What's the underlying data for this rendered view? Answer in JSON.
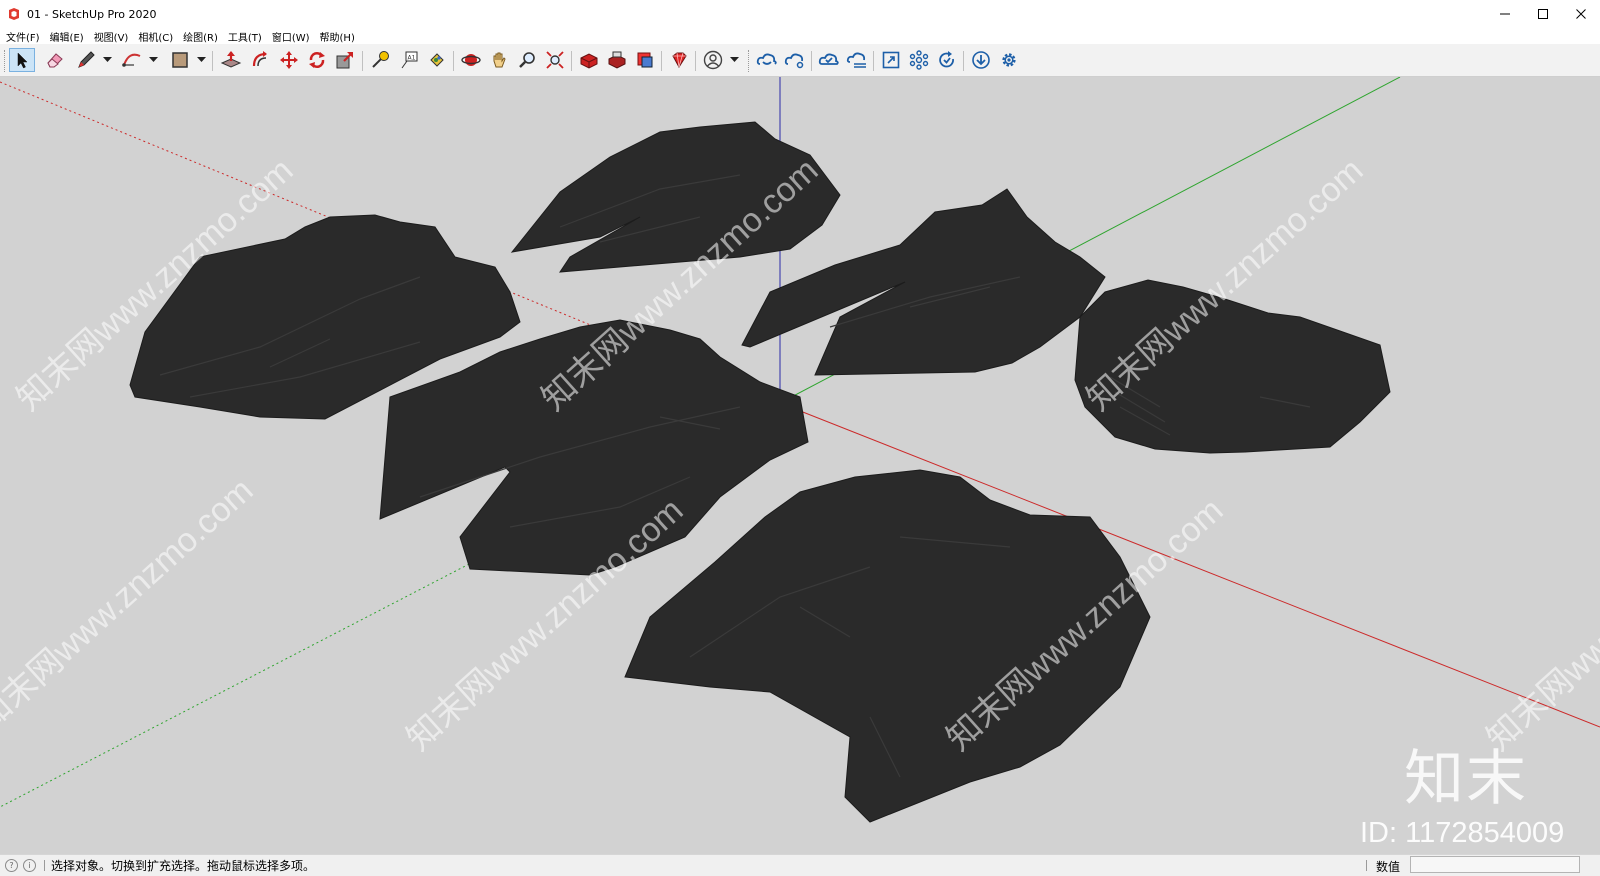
{
  "window": {
    "title": "01 - SketchUp Pro 2020",
    "controls": [
      "minimize-icon",
      "maximize-icon",
      "close-icon"
    ]
  },
  "menu": [
    {
      "label": "文件(F)"
    },
    {
      "label": "编辑(E)"
    },
    {
      "label": "视图(V)"
    },
    {
      "label": "相机(C)"
    },
    {
      "label": "绘图(R)"
    },
    {
      "label": "工具(T)"
    },
    {
      "label": "窗口(W)"
    },
    {
      "label": "帮助(H)"
    }
  ],
  "toolbar": {
    "tools": [
      {
        "name": "select-tool",
        "icon": "arrow-cursor-icon",
        "active": true
      },
      {
        "name": "eraser-tool",
        "icon": "eraser-icon"
      },
      {
        "name": "pencil-tool",
        "icon": "pencil-icon",
        "dropdown": true
      },
      {
        "name": "arc-tool",
        "icon": "arc-icon",
        "dropdown": true
      },
      {
        "name": "rectangle-tool",
        "icon": "rectangle-icon",
        "dropdown": true
      },
      {
        "name": "push-pull-tool",
        "icon": "push-pull-icon"
      },
      {
        "name": "offset-tool",
        "icon": "offset-icon"
      },
      {
        "name": "move-tool",
        "icon": "move-icon"
      },
      {
        "name": "rotate-tool",
        "icon": "rotate-icon"
      },
      {
        "name": "scale-tool",
        "icon": "scale-icon"
      },
      {
        "name": "tape-measure-tool",
        "icon": "tape-measure-icon"
      },
      {
        "name": "text-tool",
        "icon": "text-label-icon"
      },
      {
        "name": "paint-bucket-tool",
        "icon": "paint-bucket-icon"
      },
      {
        "name": "orbit-tool",
        "icon": "orbit-icon"
      },
      {
        "name": "pan-tool",
        "icon": "hand-icon"
      },
      {
        "name": "zoom-tool",
        "icon": "magnifier-icon"
      },
      {
        "name": "zoom-extents-tool",
        "icon": "zoom-extents-icon"
      },
      {
        "name": "3d-warehouse-button",
        "icon": "warehouse-icon"
      },
      {
        "name": "extension-warehouse-button",
        "icon": "extension-warehouse-icon"
      },
      {
        "name": "send-to-layout-button",
        "icon": "layout-icon"
      },
      {
        "name": "extension-manager-button",
        "icon": "ruby-gem-icon"
      },
      {
        "name": "account-button",
        "icon": "user-icon",
        "dropdown": true
      },
      {
        "name": "trimble-connect-button",
        "icon": "cloud-link-icon"
      },
      {
        "name": "cloud-share-button",
        "icon": "cloud-share-icon"
      },
      {
        "name": "cloud-sync-button",
        "icon": "cloud-check-icon"
      },
      {
        "name": "cloud-collab-button",
        "icon": "cloud-lines-icon"
      },
      {
        "name": "expand-view-button",
        "icon": "expand-icon"
      },
      {
        "name": "components-button",
        "icon": "molecule-icon"
      },
      {
        "name": "refresh-check-button",
        "icon": "refresh-check-icon"
      },
      {
        "name": "download-button",
        "icon": "download-icon"
      },
      {
        "name": "settings-button",
        "icon": "gear-icon"
      }
    ]
  },
  "viewport": {
    "background": "#d2d2d2",
    "model_color": "#2a2a2a",
    "axis_colors": {
      "red": "#cc2a2a",
      "green": "#2fa52f",
      "blue": "#2a2aa8"
    },
    "watermark_text": "知末网www.znzmo.com",
    "brand_mark": "知末",
    "brand_id": "ID: 1172854009"
  },
  "statusbar": {
    "icons": [
      "geo-location-icon",
      "info-icon"
    ],
    "hint": "选择对象。切换到扩充选择。拖动鼠标选择多项。",
    "measurements_label": "数值",
    "measurements_value": ""
  }
}
